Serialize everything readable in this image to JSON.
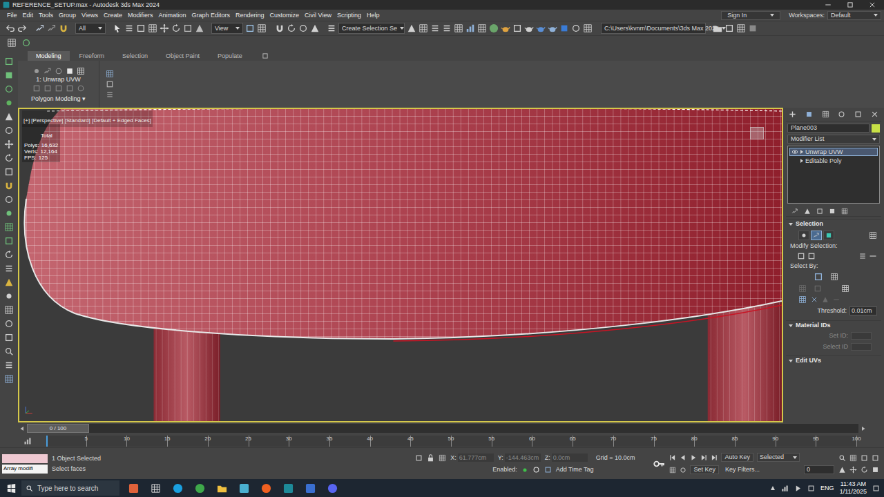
{
  "window": {
    "title": "REFERENCE_SETUP.max - Autodesk 3ds Max 2024"
  },
  "menu": [
    "File",
    "Edit",
    "Tools",
    "Group",
    "Views",
    "Create",
    "Modifiers",
    "Animation",
    "Graph Editors",
    "Rendering",
    "Customize",
    "Civil View",
    "Scripting",
    "Help"
  ],
  "account": {
    "sign_in": "Sign In",
    "workspaces_label": "Workspaces:",
    "workspace": "Default"
  },
  "toolbar": {
    "selection_filter": "All",
    "reference_coord": "View",
    "named_selection": "Create Selection Se",
    "project_path": "C:\\Users\\kvnm\\Documents\\3ds Max 2024"
  },
  "ribbon": {
    "tabs": [
      {
        "label": "Modeling",
        "selected": true
      },
      {
        "label": "Freeform",
        "selected": false
      },
      {
        "label": "Selection",
        "selected": false
      },
      {
        "label": "Object Paint",
        "selected": false
      },
      {
        "label": "Populate",
        "selected": false
      }
    ],
    "modifier": "1: Unwrap UVW",
    "panel_title": "Polygon Modeling ▾"
  },
  "viewport": {
    "label": "[+] [Perspective] [Standard] [Default + Edged Faces]",
    "active": true,
    "stats_title": "Total",
    "stats": [
      {
        "label": "Polys:",
        "value": "16,632"
      },
      {
        "label": "Verts:",
        "value": "12,164"
      },
      {
        "label": "FPS:",
        "value": "125"
      }
    ]
  },
  "command_panel": {
    "object_name": "Plane003",
    "modifier_list": "Modifier List",
    "stack": [
      {
        "label": "Unwrap UVW",
        "selected": true,
        "visible": true
      },
      {
        "label": "Editable Poly",
        "selected": false,
        "visible": false
      }
    ],
    "selection": {
      "title": "Selection",
      "expanded": true,
      "subobject_modes": [
        {
          "selected": false
        },
        {
          "selected": true
        },
        {
          "selected": false
        }
      ],
      "modify_label": "Modify Selection:",
      "select_by_label": "Select By:",
      "threshold_label": "Threshold:",
      "threshold": "0.01cm"
    },
    "material_ids": {
      "title": "Material IDs",
      "expanded": true,
      "fields": [
        {
          "label": "Set ID:",
          "disabled": true
        },
        {
          "label": "Select ID",
          "disabled": true
        }
      ]
    },
    "edit_uvs": {
      "title": "Edit UVs",
      "expanded": true
    }
  },
  "timeline": {
    "position": "0 / 100",
    "level": 0,
    "ticks": [
      "5",
      "10",
      "15",
      "20",
      "25",
      "30",
      "35",
      "40",
      "45",
      "50",
      "55",
      "60",
      "65",
      "70",
      "75",
      "80",
      "85",
      "90",
      "95",
      "100"
    ]
  },
  "status": {
    "script_input": "Array modifi",
    "selection": "1 Object Selected",
    "prompt": "Select faces",
    "coords": [
      {
        "label": "X:",
        "value": "61.777cm",
        "disabled": true
      },
      {
        "label": "Y:",
        "value": "-144.463cm",
        "disabled": true
      },
      {
        "label": "Z:",
        "value": "0.0cm",
        "disabled": true
      }
    ],
    "grid": "Grid = 10.0cm",
    "enabled_label": "Enabled:",
    "add_time_tag": "Add Time Tag",
    "auto_key": "Auto Key",
    "key_mode": "Selected",
    "set_key": "Set Key",
    "key_filters": "Key Filters...",
    "frame": "0"
  },
  "taskbar": {
    "search_placeholder": "Type here to search",
    "language": "ENG",
    "time": "11:43 AM",
    "date": "1/11/2025"
  }
}
